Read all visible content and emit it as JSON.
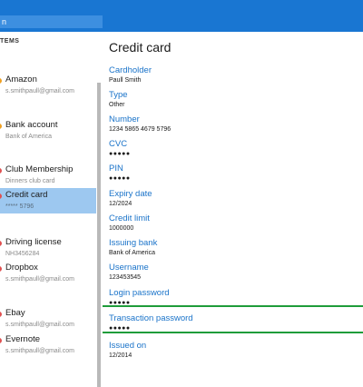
{
  "search": {
    "placeholder": "n"
  },
  "sidebar": {
    "header": "TEMS",
    "items": [
      {
        "title": "Amazon",
        "sub": "s.smithpaull@gmail.com",
        "color": "#f0a020"
      },
      {
        "title": "Bank account",
        "sub": "Bank of America",
        "color": "#f0a020"
      },
      {
        "title": "Club Membership",
        "sub": "Dinners club card",
        "color": "#e05050"
      },
      {
        "title": "Credit card",
        "sub": "***** 5796",
        "color": "#e05050"
      },
      {
        "title": "Driving license",
        "sub": "NH3456284",
        "color": "#e05050"
      },
      {
        "title": "Dropbox",
        "sub": "s.smithpaull@gmail.com",
        "color": "#e05050"
      },
      {
        "title": "Ebay",
        "sub": "s.smithpaull@gmail.com",
        "color": "#e05050"
      },
      {
        "title": "Evernote",
        "sub": "s.smithpaull@gmail.com",
        "color": "#e05050"
      }
    ]
  },
  "detail": {
    "title": "Credit card",
    "fields": [
      {
        "label": "Cardholder",
        "value": "Paull Smith"
      },
      {
        "label": "Type",
        "value": "Other"
      },
      {
        "label": "Number",
        "value": "1234 5865 4679 5796"
      },
      {
        "label": "CVC",
        "value": "●●●●●"
      },
      {
        "label": "PIN",
        "value": "●●●●●"
      },
      {
        "label": "Expiry date",
        "value": "12/2024"
      },
      {
        "label": "Credit limit",
        "value": "1000000"
      },
      {
        "label": "Issuing bank",
        "value": "Bank of America"
      },
      {
        "label": "Username",
        "value": "123453545"
      },
      {
        "label": "Login password",
        "value": "●●●●●"
      },
      {
        "label": "Transaction password",
        "value": "●●●●●"
      },
      {
        "label": "Issued on",
        "value": "12/2014"
      }
    ]
  },
  "colors": {
    "accent": "#1976d2",
    "selection": "#9dc8f0",
    "strength": "#1f9c3a",
    "label": "#1a73c9"
  }
}
